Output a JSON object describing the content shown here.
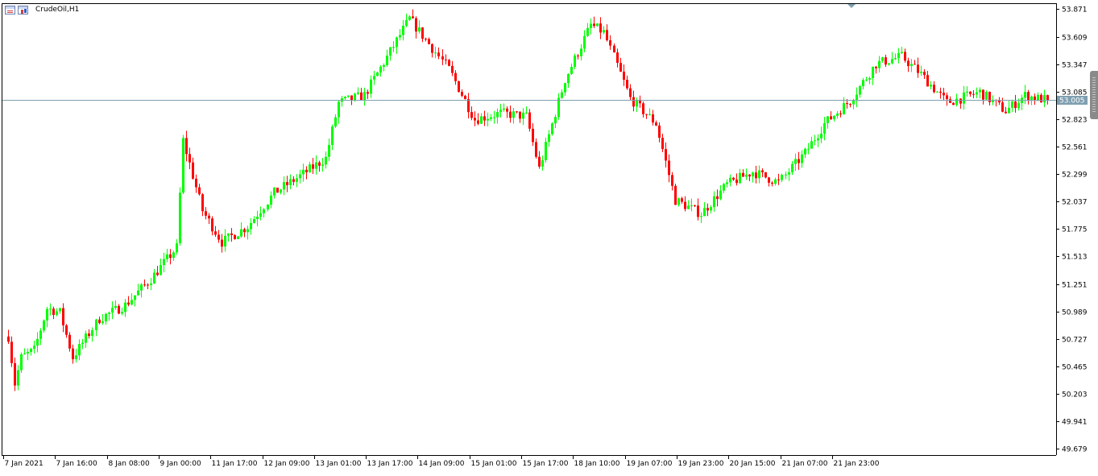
{
  "window": {
    "symbol_title": "CrudeOil,H1",
    "icons": [
      "chart-window-icon",
      "bar-chart-icon"
    ]
  },
  "colors": {
    "background": "#ffffff",
    "bull_candle": "#00ff00",
    "bear_candle": "#ff0000",
    "axis": "#000000",
    "current_price_line": "#7f9fb0",
    "price_badge": "#7f9fb0"
  },
  "chart_data": {
    "type": "candlestick",
    "symbol": "CrudeOil",
    "timeframe": "H1",
    "current_price": 53.005,
    "current_price_label": "53.005",
    "ylim": [
      49.62,
      53.92
    ],
    "y_ticks": [
      "53.871",
      "53.609",
      "53.347",
      "53.085",
      "52.823",
      "52.561",
      "52.299",
      "52.037",
      "51.775",
      "51.513",
      "51.251",
      "50.989",
      "50.727",
      "50.465",
      "50.203",
      "49.941",
      "49.679"
    ],
    "x_ticks": [
      "7 Jan 2021",
      "7 Jan 16:00",
      "8 Jan 08:00",
      "9 Jan 00:00",
      "11 Jan 17:00",
      "12 Jan 09:00",
      "13 Jan 01:00",
      "13 Jan 17:00",
      "14 Jan 09:00",
      "15 Jan 01:00",
      "15 Jan 17:00",
      "18 Jan 10:00",
      "19 Jan 07:00",
      "19 Jan 23:00",
      "20 Jan 15:00",
      "21 Jan 07:00",
      "21 Jan 23:00"
    ],
    "candles_per_label": 16,
    "key_points": [
      [
        0,
        50.75
      ],
      [
        2,
        50.3
      ],
      [
        4,
        50.55
      ],
      [
        8,
        50.62
      ],
      [
        12,
        51.02
      ],
      [
        16,
        50.98
      ],
      [
        20,
        50.55
      ],
      [
        28,
        50.92
      ],
      [
        36,
        51.05
      ],
      [
        44,
        51.3
      ],
      [
        52,
        51.6
      ],
      [
        54,
        52.62
      ],
      [
        60,
        51.95
      ],
      [
        66,
        51.65
      ],
      [
        74,
        51.8
      ],
      [
        82,
        52.12
      ],
      [
        90,
        52.28
      ],
      [
        98,
        52.45
      ],
      [
        102,
        52.98
      ],
      [
        110,
        53.05
      ],
      [
        124,
        53.78
      ],
      [
        136,
        53.3
      ],
      [
        144,
        52.82
      ],
      [
        152,
        52.88
      ],
      [
        160,
        52.85
      ],
      [
        164,
        52.35
      ],
      [
        172,
        53.2
      ],
      [
        180,
        53.72
      ],
      [
        184,
        53.65
      ],
      [
        192,
        53.02
      ],
      [
        200,
        52.78
      ],
      [
        206,
        52.05
      ],
      [
        214,
        51.92
      ],
      [
        222,
        52.2
      ],
      [
        230,
        52.32
      ],
      [
        238,
        52.22
      ],
      [
        246,
        52.5
      ],
      [
        252,
        52.78
      ],
      [
        260,
        53.0
      ],
      [
        268,
        53.35
      ],
      [
        276,
        53.42
      ],
      [
        282,
        53.25
      ],
      [
        290,
        52.98
      ],
      [
        300,
        53.08
      ],
      [
        308,
        52.9
      ],
      [
        314,
        53.05
      ],
      [
        318,
        53.02
      ],
      [
        321,
        53.005
      ]
    ]
  }
}
